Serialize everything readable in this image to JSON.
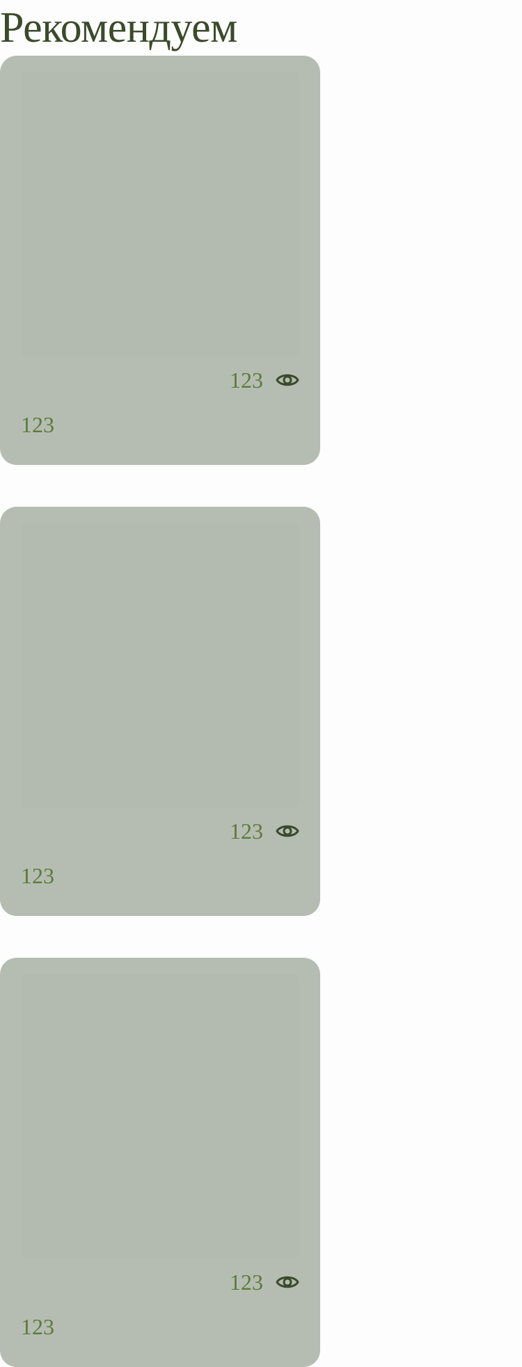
{
  "section": {
    "title": "Рекомендуем"
  },
  "colors": {
    "title": "#3b4a2a",
    "card_background": "#b5bdb2",
    "text_accent": "#5c7a3a",
    "icon": "#3b4a2a",
    "page_background": "#fdfdfd"
  },
  "cards": [
    {
      "views": "123",
      "views_icon": "eye-icon",
      "value": "123"
    },
    {
      "views": "123",
      "views_icon": "eye-icon",
      "value": "123"
    },
    {
      "views": "123",
      "views_icon": "eye-icon",
      "value": "123"
    }
  ]
}
